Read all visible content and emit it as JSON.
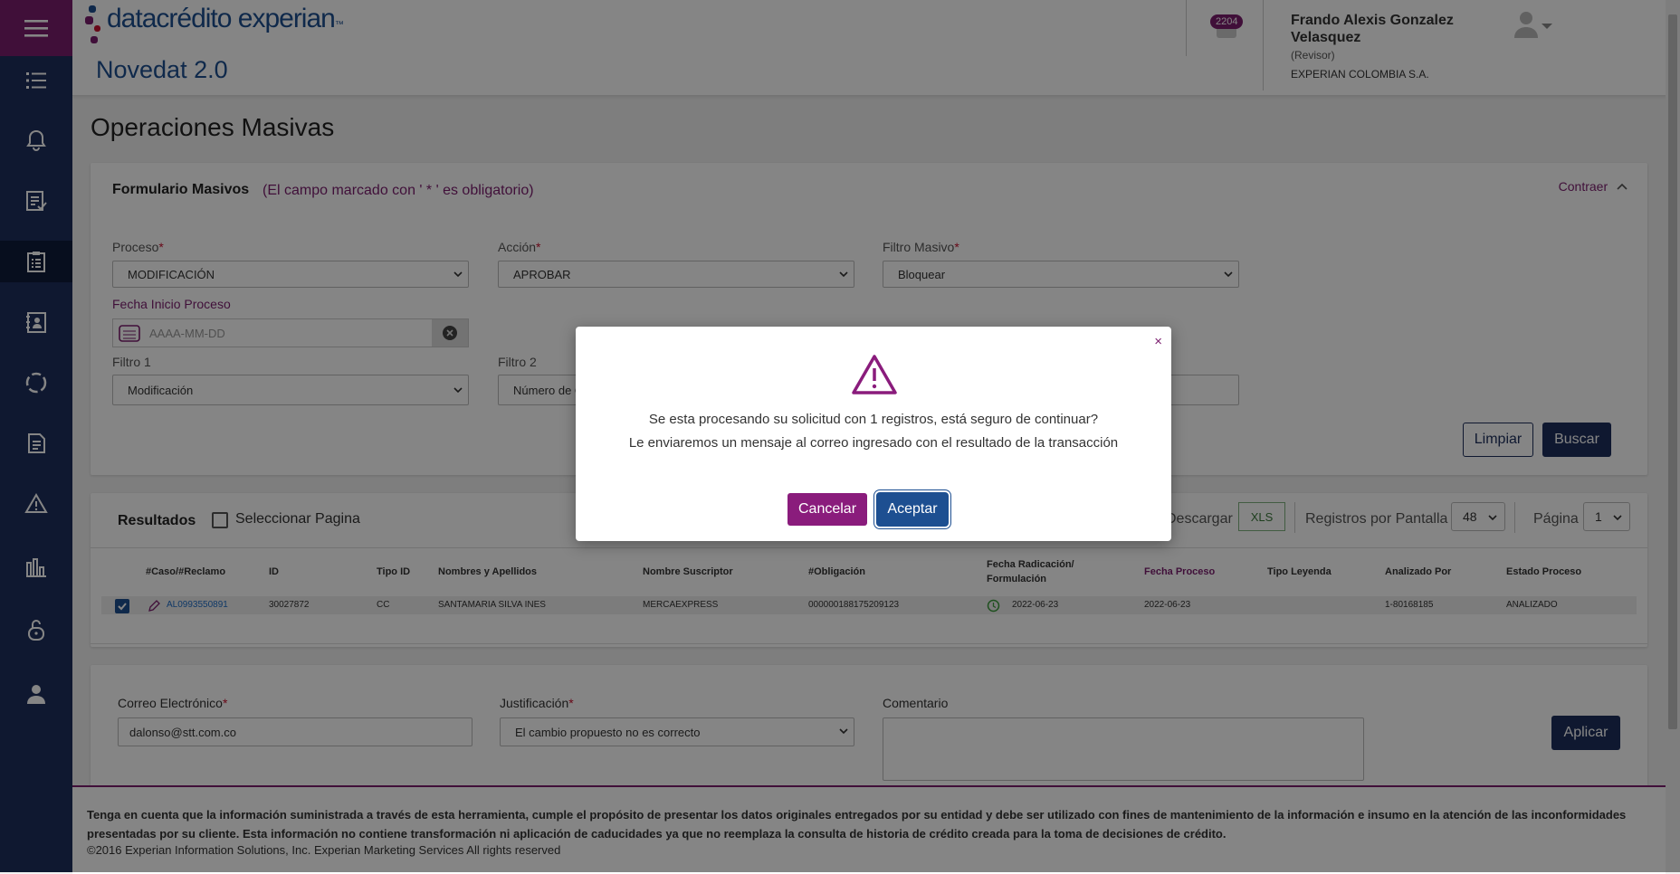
{
  "header": {
    "logo_text": "datacrédito experian",
    "logo_tm": "™",
    "app_name": "Novedat 2.0",
    "notification_count": "2204",
    "user_name": "Frando Alexis Gonzalez Velasquez",
    "user_role": "(Revisor)",
    "user_company": "EXPERIAN COLOMBIA S.A."
  },
  "sidebar": {
    "items": [
      {
        "icon": "list-icon"
      },
      {
        "icon": "bell-icon"
      },
      {
        "icon": "checklist-icon"
      },
      {
        "icon": "clipboard-icon",
        "active": true
      },
      {
        "icon": "contacts-icon"
      },
      {
        "icon": "sync-icon"
      },
      {
        "icon": "document-icon"
      },
      {
        "icon": "warning-icon"
      },
      {
        "icon": "reports-icon"
      },
      {
        "icon": "unlock-icon"
      },
      {
        "icon": "user-icon"
      }
    ]
  },
  "page": {
    "title": "Operaciones Masivas"
  },
  "form": {
    "title": "Formulario Masivos",
    "note": "(El campo marcado con ' * ' es obligatorio)",
    "collapse_label": "Contraer",
    "proceso_label": "Proceso",
    "proceso_value": "MODIFICACIÓN",
    "accion_label": "Acción",
    "accion_value": "APROBAR",
    "filtro_masivo_label": "Filtro Masivo",
    "filtro_masivo_value": "Bloquear",
    "fecha_label": "Fecha Inicio Proceso",
    "fecha_placeholder": "AAAA-MM-DD",
    "filtro1_label": "Filtro 1",
    "filtro1_value": "Modificación",
    "filtro2_label": "Filtro 2",
    "filtro2_value": "Número de O",
    "clear_button": "Limpiar",
    "search_button": "Buscar",
    "required_mark": "*"
  },
  "results": {
    "title": "Resultados",
    "select_page_label": "Seleccionar Pagina",
    "download_label": "Descargar",
    "xls_label": "XLS",
    "per_page_label": "Registros por Pantalla",
    "per_page_value": "48",
    "page_label": "Página",
    "page_value": "1",
    "columns": {
      "caso": "#Caso/#Reclamo",
      "id": "ID",
      "tipo_id": "Tipo ID",
      "nombres": "Nombres y Apellidos",
      "suscriptor": "Nombre Suscriptor",
      "obligacion": "#Obligación",
      "fecha_radicacion": "Fecha Radicación/ Formulación",
      "fecha_proceso": "Fecha Proceso",
      "tipo_leyenda": "Tipo Leyenda",
      "analizado_por": "Analizado Por",
      "estado": "Estado Proceso"
    },
    "rows": [
      {
        "caso": "AL0993550891",
        "id": "30027872",
        "tipo_id": "CC",
        "nombres": "SANTAMARIA SILVA INES",
        "suscriptor": "MERCAEXPRESS",
        "obligacion": "000000188175209123",
        "fecha_radicacion": "2022-06-23",
        "fecha_proceso": "2022-06-23",
        "tipo_leyenda": "",
        "analizado_por": "1-80168185",
        "estado": "ANALIZADO"
      }
    ]
  },
  "apply": {
    "email_label": "Correo Electrónico",
    "email_value": "dalonso@stt.com.co",
    "justification_label": "Justificación",
    "justification_value": "El cambio propuesto no es correcto",
    "comment_label": "Comentario",
    "comment_value": "",
    "apply_button": "Aplicar"
  },
  "footer": {
    "disclaimer": "Tenga en cuenta que la información suministrada a través de esta herramienta, cumple el propósito de presentar los datos originales entregados por su entidad y debe ser utilizado con fines de mantenimiento de la información e insumo en la atención de las inconformidades presentadas por su cliente. Esta información no contiene transformación ni aplicación de caducidades ya que no reemplaza la consulta de historia de crédito creada para la toma de decisiones de crédito.",
    "copyright": "©2016 Experian Information Solutions, Inc. Experian Marketing Services All rights reserved"
  },
  "modal": {
    "close_label": "×",
    "icon": "warning-icon",
    "message_line1": "Se esta procesando su solicitud con 1 registros, está seguro de continuar?",
    "message_line2": "Le enviaremos un mensaje al correo ingresado con el resultado de la transacción",
    "cancel_button": "Cancelar",
    "accept_button": "Aceptar"
  },
  "colors": {
    "brand_magenta": "#7b1e6e",
    "brand_navy": "#1d2f5c",
    "brand_blue": "#1d4f91"
  }
}
